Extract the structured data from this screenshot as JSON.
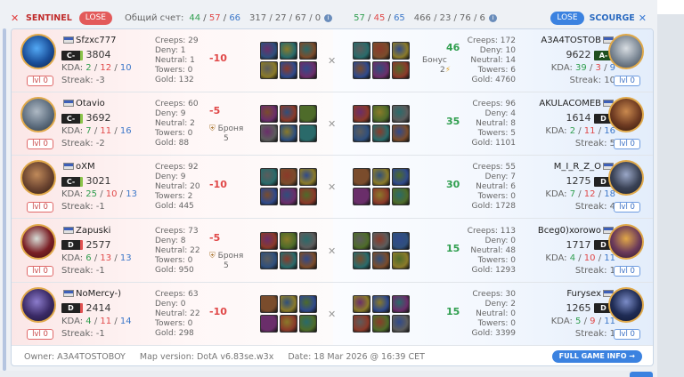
{
  "header": {
    "sentinel_label": "SENTINEL",
    "sentinel_result": "LOSE",
    "total_score_label": "Общий счет:",
    "left_score": {
      "a": "44",
      "b": "57",
      "c": "66"
    },
    "left_extra": "317 / 27 / 67 / 0",
    "right_score": {
      "a": "57",
      "b": "45",
      "c": "65"
    },
    "right_extra": "466 / 23 / 76 / 6",
    "scourge_result": "LOSE",
    "scourge_label": "SCOURGE"
  },
  "rows": [
    {
      "l": {
        "name": "Sfzxc777",
        "rank": "C-",
        "score": "3804",
        "k": "2",
        "d": "12",
        "a": "10",
        "streak": "Streak: -3",
        "lvl": "lvl 0",
        "creeps": "Creeps: 29",
        "deny": "Deny: 1",
        "neutral": "Neutral: 1",
        "towers": "Towers: 0",
        "gold": "Gold: 132",
        "delta": "-10",
        "bonus": "",
        "bonus2": ""
      },
      "r": {
        "name": "A3A4TOSTOB",
        "rank": "A-",
        "score": "9622",
        "k": "39",
        "d": "3",
        "a": "9",
        "streak": "Streak: 10",
        "lvl": "lvl 0",
        "creeps": "Creeps: 172",
        "deny": "Deny: 10",
        "neutral": "Neutral: 14",
        "towers": "Towers: 6",
        "gold": "Gold: 4760",
        "delta": "46",
        "bonus": "Бонус",
        "bonus2": "2"
      }
    },
    {
      "l": {
        "name": "Otavio",
        "rank": "C-",
        "score": "3692",
        "k": "7",
        "d": "11",
        "a": "16",
        "streak": "Streak: -2",
        "lvl": "lvl 0",
        "creeps": "Creeps: 60",
        "deny": "Deny: 9",
        "neutral": "Neutral: 2",
        "towers": "Towers: 0",
        "gold": "Gold: 88",
        "delta": "-5",
        "bonus": "Броня",
        "bonus2": "5"
      },
      "r": {
        "name": "AKULACOMEB",
        "rank": "D",
        "score": "1614",
        "k": "2",
        "d": "11",
        "a": "16",
        "streak": "Streak: 5",
        "lvl": "lvl 0",
        "creeps": "Creeps: 96",
        "deny": "Deny: 4",
        "neutral": "Neutral: 8",
        "towers": "Towers: 5",
        "gold": "Gold: 1101",
        "delta": "35",
        "bonus": "",
        "bonus2": ""
      }
    },
    {
      "l": {
        "name": "oXM",
        "rank": "C-",
        "score": "3021",
        "k": "25",
        "d": "10",
        "a": "13",
        "streak": "Streak: -1",
        "lvl": "lvl 0",
        "creeps": "Creeps: 92",
        "deny": "Deny: 9",
        "neutral": "Neutral: 20",
        "towers": "Towers: 2",
        "gold": "Gold: 445",
        "delta": "-10",
        "bonus": "",
        "bonus2": ""
      },
      "r": {
        "name": "M_I_R_Z_O",
        "rank": "D",
        "score": "1275",
        "k": "7",
        "d": "12",
        "a": "18",
        "streak": "Streak: 4",
        "lvl": "lvl 0",
        "creeps": "Creeps: 55",
        "deny": "Deny: 7",
        "neutral": "Neutral: 6",
        "towers": "Towers: 0",
        "gold": "Gold: 1728",
        "delta": "30",
        "bonus": "",
        "bonus2": ""
      }
    },
    {
      "l": {
        "name": "Zapuski",
        "rank": "D",
        "score": "2577",
        "k": "6",
        "d": "13",
        "a": "13",
        "streak": "Streak: -1",
        "lvl": "lvl 0",
        "creeps": "Creeps: 73",
        "deny": "Deny: 8",
        "neutral": "Neutral: 22",
        "towers": "Towers: 0",
        "gold": "Gold: 950",
        "delta": "-5",
        "bonus": "Броня",
        "bonus2": "5"
      },
      "r": {
        "name": "Bceg0)xorowo",
        "rank": "D",
        "score": "1717",
        "k": "4",
        "d": "10",
        "a": "11",
        "streak": "Streak: 1",
        "lvl": "lvl 0",
        "creeps": "Creeps: 113",
        "deny": "Deny: 0",
        "neutral": "Neutral: 48",
        "towers": "Towers: 0",
        "gold": "Gold: 1293",
        "delta": "15",
        "bonus": "",
        "bonus2": ""
      }
    },
    {
      "l": {
        "name": "NoMercy-)",
        "rank": "D",
        "score": "2414",
        "k": "4",
        "d": "11",
        "a": "14",
        "streak": "Streak: -1",
        "lvl": "lvl 0",
        "creeps": "Creeps: 63",
        "deny": "Deny: 0",
        "neutral": "Neutral: 22",
        "towers": "Towers: 0",
        "gold": "Gold: 298",
        "delta": "-10",
        "bonus": "",
        "bonus2": ""
      },
      "r": {
        "name": "Furysex",
        "rank": "D",
        "score": "1265",
        "k": "5",
        "d": "9",
        "a": "11",
        "streak": "Streak: 1",
        "lvl": "lvl 0",
        "creeps": "Creeps: 30",
        "deny": "Deny: 2",
        "neutral": "Neutral: 0",
        "towers": "Towers: 0",
        "gold": "Gold: 3399",
        "delta": "15",
        "bonus": "",
        "bonus2": ""
      }
    }
  ],
  "footer": {
    "owner": "Owner: A3A4TOSTOBOY",
    "map": "Map version: DotA v6.83se.w3x",
    "date": "Date: 18 Mar 2026 @ 16:39 CET",
    "button": "FULL GAME INFO →"
  },
  "colors": {
    "sentinel": "#e35a5a",
    "scourge": "#3b82e0",
    "positive": "#2f9e4e",
    "negative": "#e04848"
  }
}
